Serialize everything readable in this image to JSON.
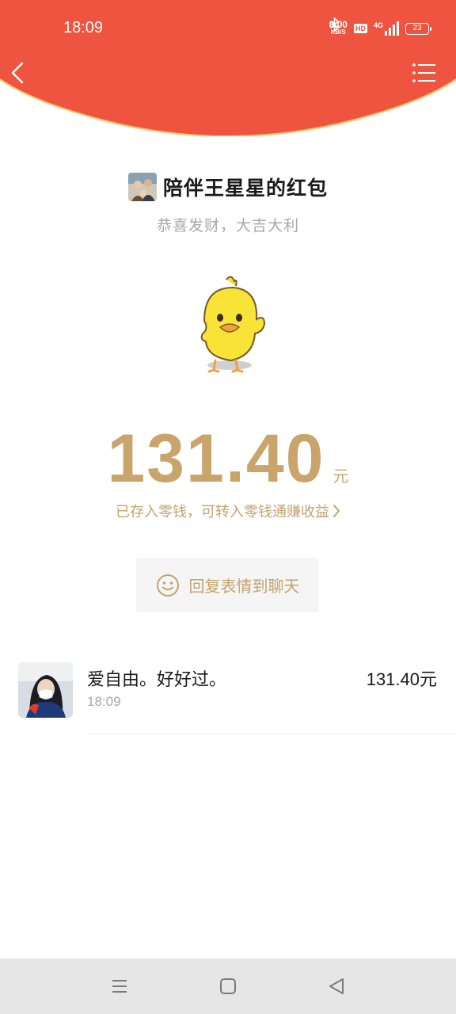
{
  "status_bar": {
    "time": "18:09",
    "net_speed_value": "8.00",
    "net_speed_unit": "KB/S",
    "hd_badge": "HD",
    "network": "4G",
    "battery": "23"
  },
  "header": {
    "color": "#ef5440",
    "accent": "#f7c86b",
    "back_icon": "chevron-left-icon",
    "menu_icon": "list-menu-icon"
  },
  "packet": {
    "sender_title": "陪伴王星星的红包",
    "greeting": "恭喜发财，大吉大利",
    "amount": "131.40",
    "unit": "元",
    "status_text": "已存入零钱，可转入零钱通赚收益",
    "reply_button_label": "回复表情到聊天",
    "amount_color": "#c9a56b"
  },
  "records": [
    {
      "name": "爱自由。好好过。",
      "time": "18:09",
      "amount": "131.40元"
    }
  ],
  "nav": {
    "items": [
      "menu-icon",
      "home-square-icon",
      "back-triangle-icon"
    ]
  }
}
